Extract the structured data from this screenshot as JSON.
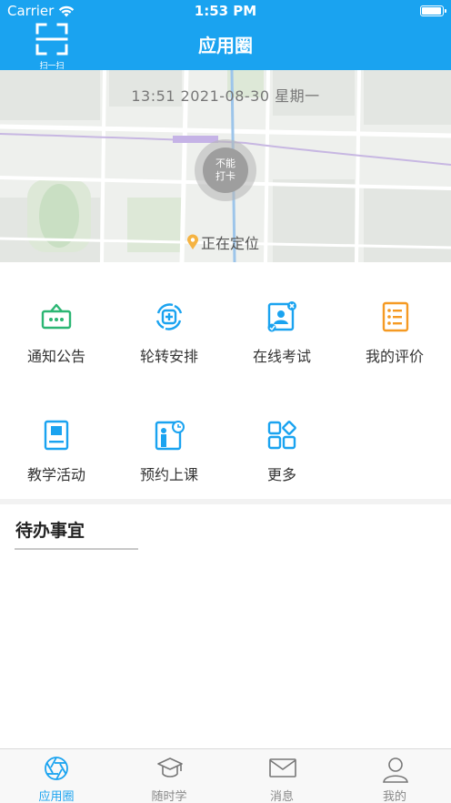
{
  "status_bar": {
    "carrier": "Carrier",
    "time": "1:53 PM",
    "battery_level": 1.0
  },
  "header": {
    "title": "应用圈",
    "scan_label": "扫一扫"
  },
  "map": {
    "datetime": "13:51  2021-08-30  星期一",
    "clock_button_line1": "不能",
    "clock_button_line2": "打卡",
    "location_status": "正在定位"
  },
  "features": [
    {
      "label": "通知公告",
      "icon": "announcement-icon",
      "color": "#2bb673"
    },
    {
      "label": "轮转安排",
      "icon": "rotation-icon",
      "color": "#1aa3f0"
    },
    {
      "label": "在线考试",
      "icon": "exam-icon",
      "color": "#1aa3f0"
    },
    {
      "label": "我的评价",
      "icon": "evaluation-icon",
      "color": "#f59a23"
    },
    {
      "label": "教学活动",
      "icon": "teaching-icon",
      "color": "#1aa3f0"
    },
    {
      "label": "预约上课",
      "icon": "booking-icon",
      "color": "#1aa3f0"
    },
    {
      "label": "更多",
      "icon": "more-icon",
      "color": "#1aa3f0"
    }
  ],
  "todo": {
    "title": "待办事宜"
  },
  "tabbar": {
    "active_color": "#1aa3f0",
    "items": [
      {
        "label": "应用圈",
        "icon": "aperture-icon"
      },
      {
        "label": "随时学",
        "icon": "graduation-cap-icon"
      },
      {
        "label": "消息",
        "icon": "mail-icon"
      },
      {
        "label": "我的",
        "icon": "user-icon"
      }
    ]
  }
}
